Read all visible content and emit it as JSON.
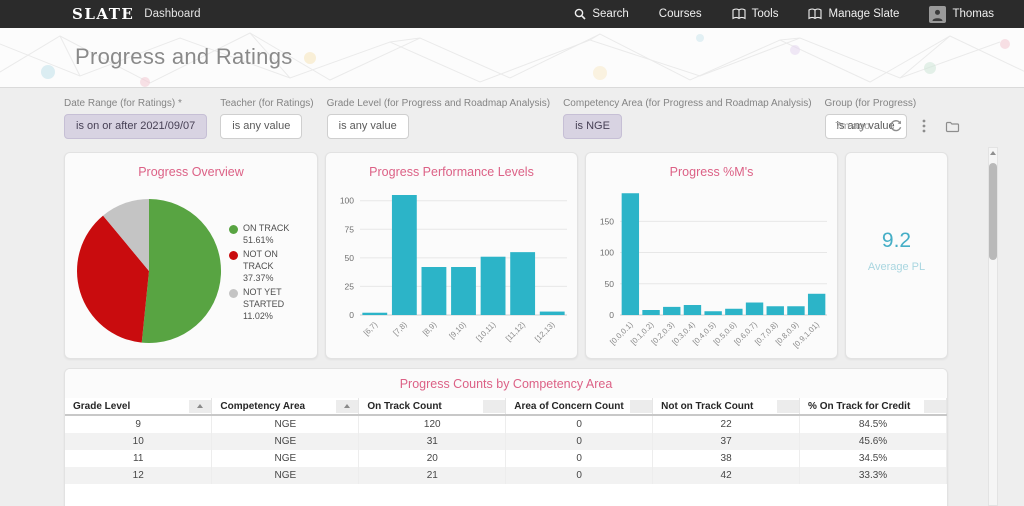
{
  "topbar": {
    "logo": "SLATE",
    "app": "Dashboard",
    "nav": [
      {
        "label": "Search"
      },
      {
        "label": "Courses"
      },
      {
        "label": "Tools"
      },
      {
        "label": "Manage Slate"
      },
      {
        "label": "Thomas"
      }
    ]
  },
  "header": {
    "title": "Progress and Ratings"
  },
  "filters": [
    {
      "label": "Date Range (for Ratings) *",
      "value": "is on or after 2021/09/07"
    },
    {
      "label": "Teacher (for Ratings)",
      "value": "is any value"
    },
    {
      "label": "Grade Level (for Progress and Roadmap Analysis)",
      "value": "is any value"
    },
    {
      "label": "Competency Area (for Progress and Roadmap Analysis)",
      "value": "is NGE"
    },
    {
      "label": "Group (for Progress)",
      "value": "is any value"
    }
  ],
  "toolbar": {
    "last_refresh": "7m ago"
  },
  "colors": {
    "accent_pink": "#dc6186",
    "bar_teal": "#2cb4c8",
    "pie_green": "#58a442",
    "pie_red": "#c90c0e",
    "pie_gray": "#c4c4c4",
    "single_value_teal": "#45aec6"
  },
  "chart_data": [
    {
      "type": "pie",
      "title": "Progress Overview",
      "slices": [
        {
          "label": "ON TRACK",
          "pct": 51.61,
          "pct_label": "51.61%",
          "color": "#58a442"
        },
        {
          "label": "NOT ON TRACK",
          "pct": 37.37,
          "pct_label": "37.37%",
          "color": "#c90c0e"
        },
        {
          "label": "NOT YET STARTED",
          "pct": 11.02,
          "pct_label": "11.02%",
          "color": "#c4c4c4"
        }
      ],
      "legend_position": "right"
    },
    {
      "type": "bar",
      "title": "Progress Performance Levels",
      "categories": [
        "[6,7)",
        "[7,8)",
        "[8,9)",
        "[9,10)",
        "[10,11)",
        "[11,12)",
        "[12,13)"
      ],
      "values": [
        2,
        105,
        42,
        42,
        51,
        55,
        3
      ],
      "yticks": [
        0,
        25,
        50,
        75,
        100
      ],
      "ylim": [
        0,
        112
      ],
      "grid": true
    },
    {
      "type": "bar",
      "title": "Progress %M's",
      "categories": [
        "[0.0,0.1)",
        "[0.1,0.2)",
        "[0.2,0.3)",
        "[0.3,0.4)",
        "[0.4,0.5)",
        "[0.5,0.6)",
        "[0.6,0.7)",
        "[0.7,0.8)",
        "[0.8,0.9)",
        "[0.9,1.01)"
      ],
      "values": [
        195,
        8,
        13,
        16,
        6,
        10,
        20,
        14,
        14,
        34
      ],
      "yticks": [
        0,
        50,
        100,
        150
      ],
      "ylim": [
        0,
        205
      ],
      "grid": true
    },
    {
      "type": "single_value",
      "value": "9.2",
      "label": "Average PL"
    }
  ],
  "table": {
    "title": "Progress Counts by Competency Area",
    "columns": [
      {
        "label": "Grade Level",
        "sorted": true
      },
      {
        "label": "Competency Area",
        "sorted": true
      },
      {
        "label": "On Track Count",
        "sorted": false
      },
      {
        "label": "Area of Concern Count",
        "sorted": false
      },
      {
        "label": "Not on Track Count",
        "sorted": false
      },
      {
        "label": "% On Track for Credit",
        "sorted": false
      }
    ],
    "rows": [
      [
        "9",
        "NGE",
        "120",
        "0",
        "22",
        "84.5%"
      ],
      [
        "10",
        "NGE",
        "31",
        "0",
        "37",
        "45.6%"
      ],
      [
        "11",
        "NGE",
        "20",
        "0",
        "38",
        "34.5%"
      ],
      [
        "12",
        "NGE",
        "21",
        "0",
        "42",
        "33.3%"
      ]
    ]
  }
}
